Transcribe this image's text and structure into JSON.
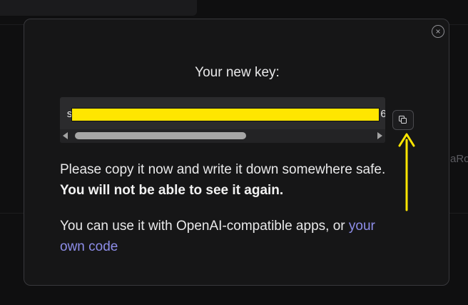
{
  "background": {
    "peek_text": "aRo"
  },
  "modal": {
    "close_symbol": "×",
    "title": "Your new key:",
    "key": {
      "visible_start": "s",
      "visible_end": "6",
      "redaction_color": "#ffe600"
    },
    "copy_button": {
      "icon": "copy-icon"
    },
    "annotation": {
      "arrow_color": "#ffe600"
    },
    "paragraph_1": {
      "text": "Please copy it now and write it down somewhere safe. ",
      "bold": "You will not be able to see it again."
    },
    "paragraph_2": {
      "text": "You can use it with OpenAI-compatible apps, or ",
      "link": "your own code"
    }
  },
  "colors": {
    "background": "#0f0f10",
    "modal": "#161617",
    "link": "#8d8de8"
  }
}
